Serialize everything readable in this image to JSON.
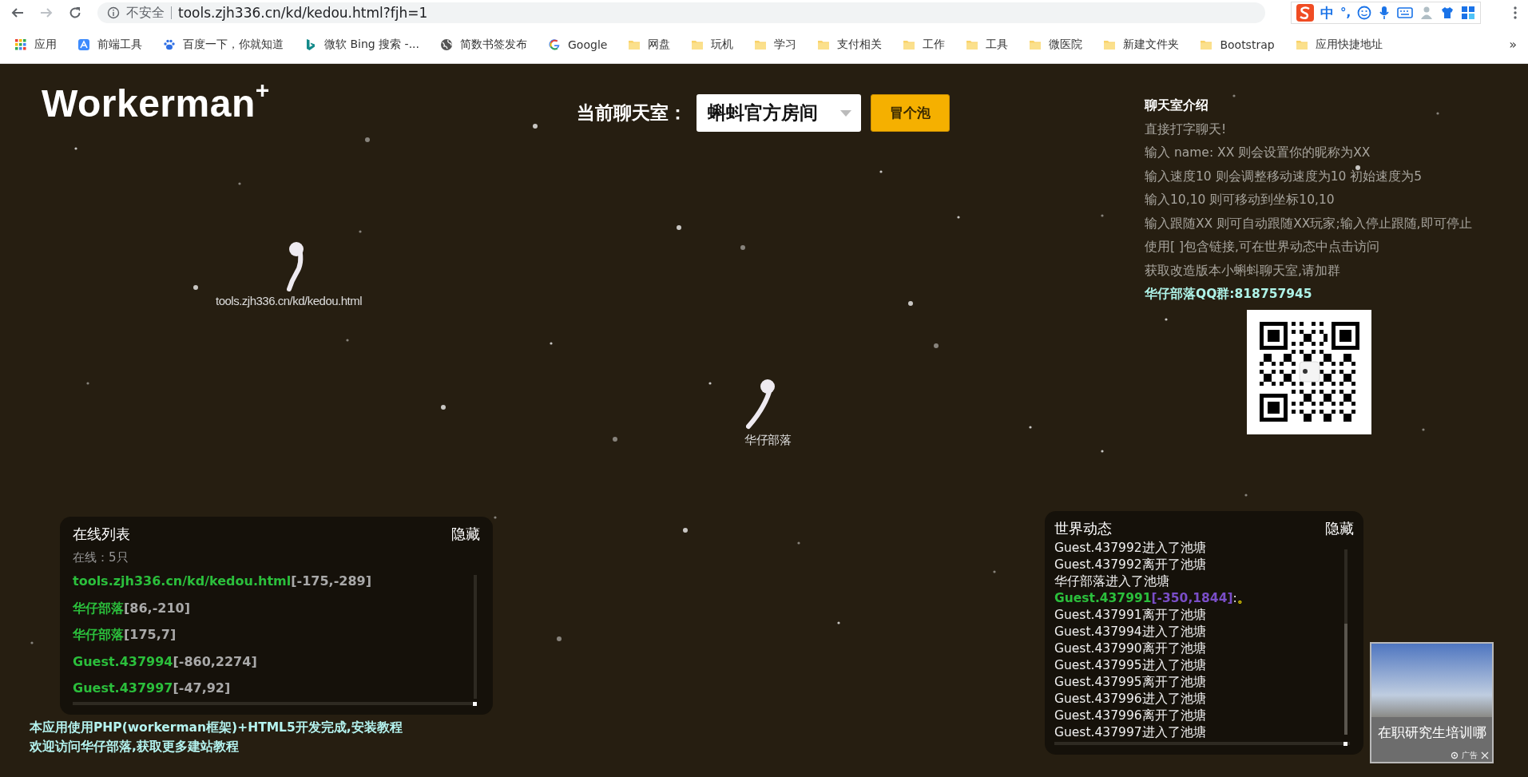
{
  "browser": {
    "security": "不安全",
    "url": "tools.zjh336.cn/kd/kedou.html?fjh=1",
    "ime": {
      "mode": "中",
      "punct": "°,"
    },
    "bookmarks": [
      {
        "label": "应用",
        "kind": "apps"
      },
      {
        "label": "前端工具",
        "kind": "tool"
      },
      {
        "label": "百度一下，你就知道",
        "kind": "paw"
      },
      {
        "label": "微软 Bing 搜索 -...",
        "kind": "bing"
      },
      {
        "label": "简数书签发布",
        "kind": "globe"
      },
      {
        "label": "Google",
        "kind": "google"
      },
      {
        "label": "网盘",
        "kind": "folder"
      },
      {
        "label": "玩机",
        "kind": "folder"
      },
      {
        "label": "学习",
        "kind": "folder"
      },
      {
        "label": "支付相关",
        "kind": "folder"
      },
      {
        "label": "工作",
        "kind": "folder"
      },
      {
        "label": "工具",
        "kind": "folder"
      },
      {
        "label": "微医院",
        "kind": "folder"
      },
      {
        "label": "新建文件夹",
        "kind": "folder"
      },
      {
        "label": "Bootstrap",
        "kind": "folder"
      },
      {
        "label": "应用快捷地址",
        "kind": "folder"
      }
    ],
    "more": "»"
  },
  "header": {
    "logo": "Workerman",
    "logo_mark": "+",
    "room_label": "当前聊天室：",
    "room": "蝌蚪官方房间",
    "bubble_button": "冒个泡"
  },
  "intro": {
    "title": "聊天室介绍",
    "lines": [
      "直接打字聊天!",
      "输入 name: XX 则会设置你的昵称为XX",
      "输入速度10 则会调整移动速度为10 初始速度为5",
      "输入10,10 则可移动到坐标10,10",
      "输入跟随XX 则可自动跟随XX玩家;输入停止跟随,即可停止",
      "使用[ ]包含链接,可在世界动态中点击访问",
      "获取改造版本小蝌蚪聊天室,请加群"
    ],
    "qq_group": "华仔部落QQ群:818757945"
  },
  "tadpoles": [
    {
      "name": "tools.zjh336.cn/kd/kedou.html"
    },
    {
      "name": "华仔部落"
    }
  ],
  "online": {
    "title": "在线列表",
    "hide": "隐藏",
    "count": "在线：5只",
    "users": [
      {
        "name": "tools.zjh336.cn/kd/kedou.html",
        "coords": "[-175,-289]"
      },
      {
        "name": "华仔部落",
        "coords": "[86,-210]"
      },
      {
        "name": "华仔部落",
        "coords": "[175,7]"
      },
      {
        "name": "Guest.437994",
        "coords": "[-860,2274]"
      },
      {
        "name": "Guest.437997",
        "coords": "[-47,92]"
      }
    ]
  },
  "footer": [
    "本应用使用PHP(workerman框架)+HTML5开发完成,安装教程",
    "欢迎访问华仔部落,获取更多建站教程"
  ],
  "world": {
    "title": "世界动态",
    "hide": "隐藏",
    "events": [
      {
        "kind": "system",
        "text": "Guest.437992进入了池塘"
      },
      {
        "kind": "system",
        "text": "Guest.437992离开了池塘"
      },
      {
        "kind": "system",
        "text": "华仔部落进入了池塘"
      },
      {
        "kind": "chat",
        "name": "Guest.437991",
        "coords": "[-350,1844]",
        "sep": ":",
        "message": "。"
      },
      {
        "kind": "system",
        "text": "Guest.437991离开了池塘"
      },
      {
        "kind": "system",
        "text": "Guest.437994进入了池塘"
      },
      {
        "kind": "system",
        "text": "Guest.437990离开了池塘"
      },
      {
        "kind": "system",
        "text": "Guest.437995进入了池塘"
      },
      {
        "kind": "system",
        "text": "Guest.437995离开了池塘"
      },
      {
        "kind": "system",
        "text": "Guest.437996进入了池塘"
      },
      {
        "kind": "system",
        "text": "Guest.437996离开了池塘"
      },
      {
        "kind": "system",
        "text": "Guest.437997进入了池塘"
      }
    ]
  },
  "ad": {
    "caption": "在职研究生培训哪",
    "badge": "广告"
  }
}
